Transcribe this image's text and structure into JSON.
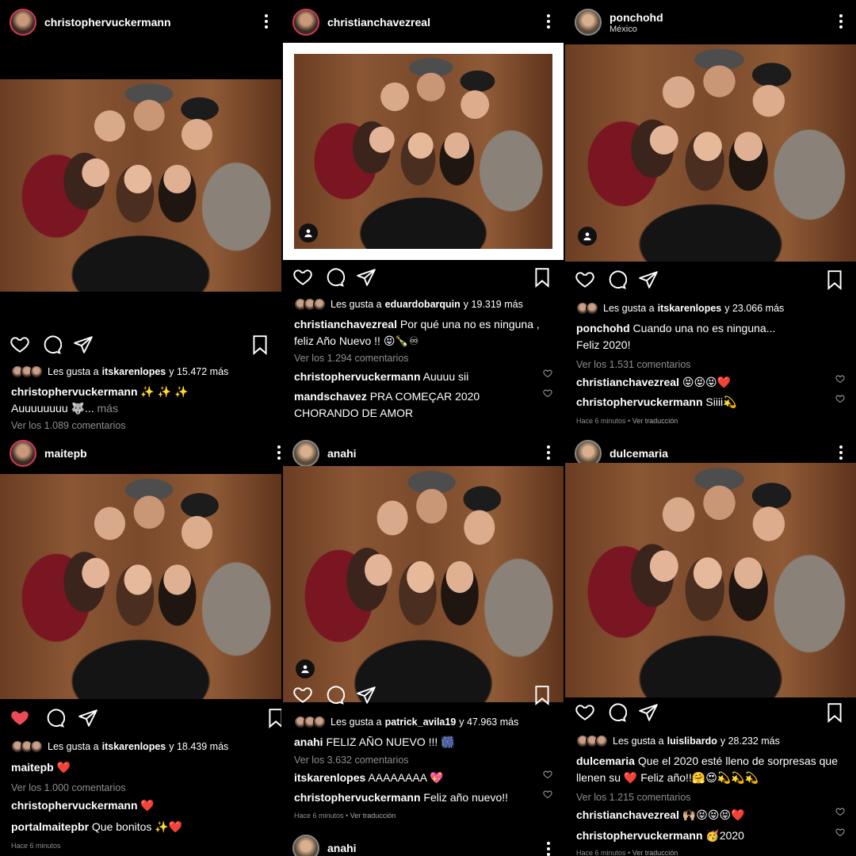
{
  "posts": [
    {
      "username": "christophervuckermann",
      "caption_user": "christophervuckermann",
      "caption": "✨ ✨ ✨",
      "caption2": "Auuuuuuuu 🐺...",
      "more": "más",
      "likes_prefix": "Les gusta a",
      "likes_user": "itskarenlopes",
      "likes_suffix": "y 15.472 más",
      "view_comments": "Ver los 1.089 comentarios"
    },
    {
      "username": "christianchavezreal",
      "likes_prefix": "Les gusta a",
      "likes_user": "eduardobarquin",
      "likes_suffix": "y 19.319 más",
      "caption_user": "christianchavezreal",
      "caption": "Por qué una no es ninguna , feliz Año Nuevo !! 😝🍾♾",
      "view_comments": "Ver los 1.294 comentarios",
      "comments": [
        {
          "user": "christophervuckermann",
          "text": "Auuuu sii"
        },
        {
          "user": "mandschavez",
          "text": "PRA COMEÇAR 2020"
        },
        {
          "user": "",
          "text": "CHORANDO DE AMOR"
        }
      ]
    },
    {
      "username": "ponchohd",
      "location": "México",
      "likes_prefix": "Les gusta a",
      "likes_user": "itskarenlopes",
      "likes_suffix": "y 23.066 más",
      "caption_user": "ponchohd",
      "caption": "Cuando una no es ninguna...",
      "caption2": "Feliz 2020!",
      "view_comments": "Ver los 1.531 comentarios",
      "comments": [
        {
          "user": "christianchavezreal",
          "text": "😝😝😝❤️"
        },
        {
          "user": "christophervuckermann",
          "text": "Siiii💫"
        }
      ],
      "time": "Hace 6 minutos",
      "translate": "Ver traducción"
    },
    {
      "username": "maitepb",
      "likes_prefix": "Les gusta a",
      "likes_user": "itskarenlopes",
      "likes_suffix": "y 18.439 más",
      "caption_user": "maitepb",
      "caption": "❤️",
      "view_comments": "Ver los 1.000 comentarios",
      "comments": [
        {
          "user": "christophervuckermann",
          "text": "❤️"
        },
        {
          "user": "portalmaitepbr",
          "text": "Que bonitos ✨❤️"
        }
      ],
      "time": "Hace 6 minutos"
    },
    {
      "username": "anahi",
      "likes_prefix": "Les gusta a",
      "likes_user": "patrick_avila19",
      "likes_suffix": "y 47.963 más",
      "caption_user": "anahi",
      "caption": "FELIZ AÑO NUEVO !!! 🎆",
      "view_comments": "Ver los 3.632 comentarios",
      "comments": [
        {
          "user": "itskarenlopes",
          "text": "AAAAAAAA 💖"
        },
        {
          "user": "christophervuckermann",
          "text": "Feliz año nuevo!!"
        }
      ],
      "time": "Hace 6 minutos",
      "translate": "Ver traducción",
      "footer_user": "anahi"
    },
    {
      "username": "dulcemaria",
      "likes_prefix": "Les gusta a",
      "likes_user": "luislibardo",
      "likes_suffix": "y 28.232 más",
      "caption_user": "dulcemaria",
      "caption": "Que el 2020 esté lleno de sorpresas que llenen su ❤️ Feliz año!!🤗😍💫💫💫",
      "view_comments": "Ver los 1.215 comentarios",
      "comments": [
        {
          "user": "christianchavezreal",
          "text": "🙌🏼😝😝😝❤️"
        },
        {
          "user": "christophervuckermann",
          "text": "🥳2020"
        }
      ],
      "time": "Hace 6 minutos",
      "translate": "Ver traducción"
    }
  ],
  "icons": [
    "heart-icon",
    "comment-icon",
    "share-icon",
    "bookmark-icon",
    "more-options-icon",
    "user-tag-icon"
  ],
  "colors": {
    "background": "#000000",
    "liked_heart": "#ed4956",
    "muted_text": "#8e8e8e"
  }
}
